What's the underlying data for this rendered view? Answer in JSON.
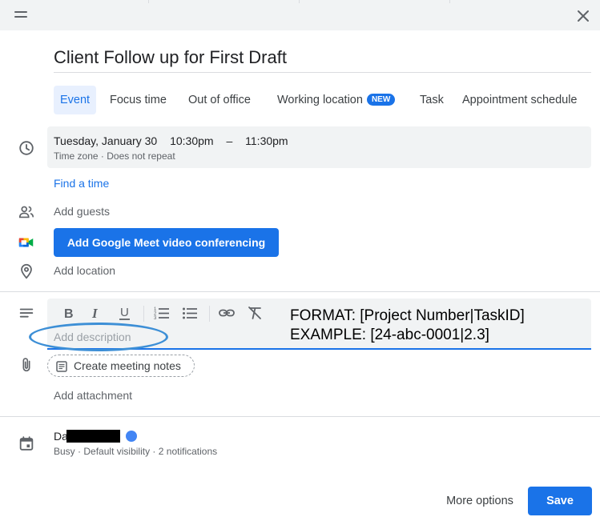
{
  "header": {
    "close_icon": "close-icon",
    "drag_icon": "drag-handle-icon"
  },
  "event": {
    "title": "Client Follow up for First Draft"
  },
  "tabs": [
    {
      "label": "Event",
      "active": true
    },
    {
      "label": "Focus time"
    },
    {
      "label": "Out of office"
    },
    {
      "label": "Working location",
      "badge": "NEW"
    },
    {
      "label": "Task"
    },
    {
      "label": "Appointment schedule"
    }
  ],
  "datetime": {
    "date": "Tuesday, January 30",
    "start": "10:30pm",
    "separator": "–",
    "end": "11:30pm",
    "timezone": "Time zone",
    "dot": "·",
    "repeat": "Does not repeat"
  },
  "find_time": "Find a time",
  "guests": {
    "placeholder": "Add guests"
  },
  "meet": {
    "label": "Add Google Meet video conferencing"
  },
  "location": {
    "placeholder": "Add location"
  },
  "description": {
    "placeholder": "Add description",
    "toolbar": [
      "bold-icon",
      "italic-icon",
      "underline-icon",
      "numbered-list-icon",
      "bulleted-list-icon",
      "link-icon",
      "remove-formatting-icon"
    ]
  },
  "annotation": {
    "line1": "FORMAT: [Project Number|TaskID]",
    "line2": "EXAMPLE: [24-abc-0001|2.3]"
  },
  "meeting_notes": {
    "label": "Create meeting notes"
  },
  "attachment": {
    "label": "Add attachment"
  },
  "owner": {
    "name_visible": "Da",
    "status": "Busy",
    "visibility": "Default visibility",
    "notifications": "2 notifications",
    "dot": "·",
    "calendar_color": "#4285f4"
  },
  "footer": {
    "more_options": "More options",
    "save": "Save"
  },
  "colors": {
    "accent": "#1a73e8",
    "toolbar_bg": "#f1f3f4",
    "annotation_ellipse": "#3d8fd6"
  }
}
